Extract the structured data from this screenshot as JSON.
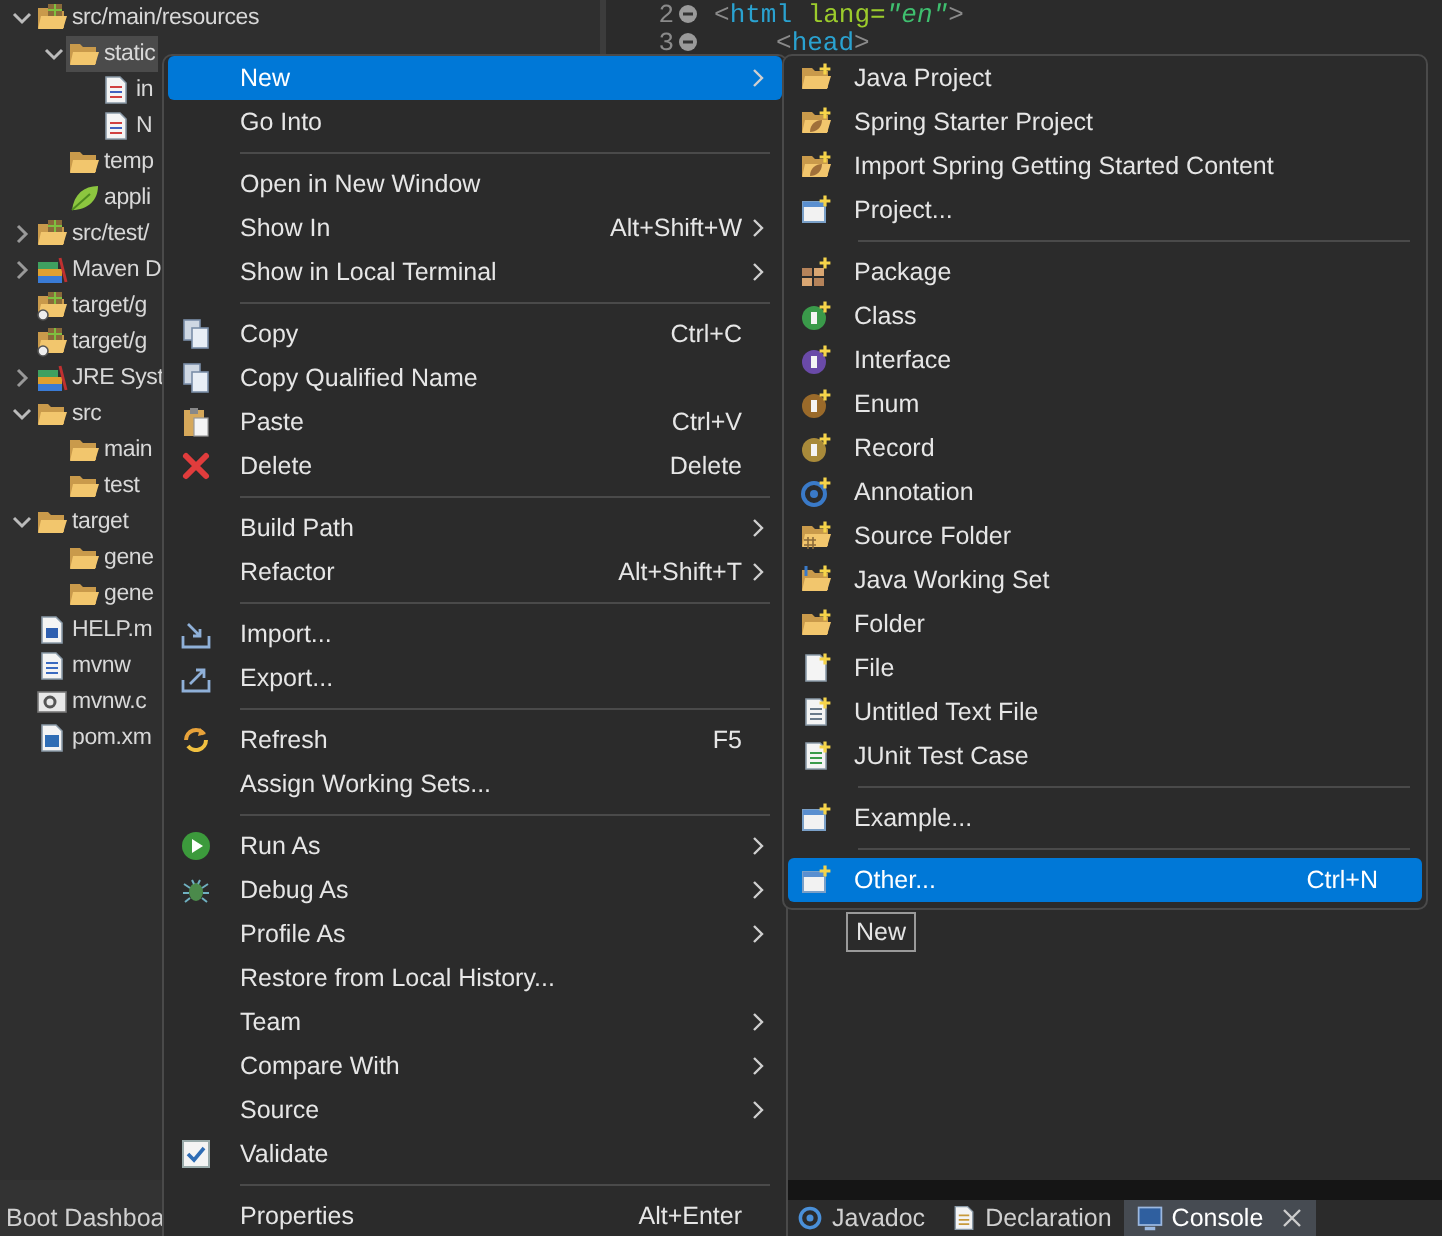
{
  "project_tree": [
    {
      "label": "src/main/resources",
      "kind": "package-folder",
      "expanded": true,
      "selected": false,
      "children": [
        {
          "label": "static",
          "kind": "folder",
          "expanded": true,
          "selected": true,
          "children": [
            {
              "label": "in",
              "kind": "html-file",
              "selected": false
            },
            {
              "label": "N",
              "kind": "html-file",
              "selected": false
            }
          ]
        },
        {
          "label": "temp",
          "kind": "folder",
          "selected": false
        },
        {
          "label": "appli",
          "kind": "spring-file",
          "selected": false
        }
      ]
    },
    {
      "label": "src/test/",
      "kind": "package-folder",
      "expanded": false,
      "selected": false
    },
    {
      "label": "Maven D",
      "kind": "library",
      "expanded": false,
      "selected": false
    },
    {
      "label": "target/g",
      "kind": "linked-package-folder",
      "selected": false
    },
    {
      "label": "target/g",
      "kind": "linked-package-folder",
      "selected": false
    },
    {
      "label": "JRE Syst",
      "kind": "library",
      "expanded": false,
      "selected": false
    },
    {
      "label": "src",
      "kind": "folder",
      "expanded": true,
      "selected": false,
      "children": [
        {
          "label": "main",
          "kind": "folder",
          "selected": false
        },
        {
          "label": "test",
          "kind": "folder",
          "selected": false
        }
      ]
    },
    {
      "label": "target",
      "kind": "folder",
      "expanded": true,
      "selected": false,
      "children": [
        {
          "label": "gene",
          "kind": "folder",
          "selected": false
        },
        {
          "label": "gene",
          "kind": "folder",
          "selected": false
        }
      ]
    },
    {
      "label": "HELP.m",
      "kind": "word-file",
      "selected": false
    },
    {
      "label": "mvnw",
      "kind": "text-file",
      "selected": false
    },
    {
      "label": "mvnw.c",
      "kind": "script-file",
      "selected": false
    },
    {
      "label": "pom.xm",
      "kind": "maven-file",
      "selected": false
    }
  ],
  "editor": {
    "lines": [
      {
        "number": "2",
        "indented": false,
        "tokens": [
          {
            "kind": "punct",
            "text": "<"
          },
          {
            "kind": "tag",
            "text": "html"
          },
          {
            "kind": "attr",
            "text": " lang="
          },
          {
            "kind": "value",
            "text": "\"en\""
          },
          {
            "kind": "punct",
            "text": ">"
          }
        ]
      },
      {
        "number": "3",
        "indented": true,
        "tokens": [
          {
            "kind": "punct",
            "text": "<"
          },
          {
            "kind": "tag",
            "text": "head"
          },
          {
            "kind": "punct",
            "text": ">"
          }
        ]
      }
    ]
  },
  "left_view_tab": {
    "label": "Boot Dashboa"
  },
  "view_tabs": [
    {
      "label": "Javadoc",
      "selected": false,
      "closable": false
    },
    {
      "label": "Declaration",
      "selected": false,
      "closable": false
    },
    {
      "label": "Console",
      "selected": true,
      "closable": true
    }
  ],
  "context_menu": {
    "items": [
      {
        "kind": "item",
        "label": "New",
        "submenu": true,
        "selected": true
      },
      {
        "kind": "item",
        "label": "Go Into",
        "submenu": false,
        "selected": false
      },
      {
        "kind": "separator"
      },
      {
        "kind": "item",
        "label": "Open in New Window",
        "submenu": false,
        "selected": false
      },
      {
        "kind": "item",
        "label": "Show In",
        "shortcut": "Alt+Shift+W",
        "submenu": true,
        "selected": false
      },
      {
        "kind": "item",
        "label": "Show in Local Terminal",
        "submenu": true,
        "selected": false
      },
      {
        "kind": "separator"
      },
      {
        "kind": "item",
        "label": "Copy",
        "shortcut": "Ctrl+C",
        "submenu": false,
        "selected": false
      },
      {
        "kind": "item",
        "label": "Copy Qualified Name",
        "submenu": false,
        "selected": false
      },
      {
        "kind": "item",
        "label": "Paste",
        "shortcut": "Ctrl+V",
        "submenu": false,
        "selected": false
      },
      {
        "kind": "item",
        "label": "Delete",
        "shortcut": "Delete",
        "submenu": false,
        "selected": false
      },
      {
        "kind": "separator"
      },
      {
        "kind": "item",
        "label": "Build Path",
        "submenu": true,
        "selected": false
      },
      {
        "kind": "item",
        "label": "Refactor",
        "shortcut": "Alt+Shift+T",
        "submenu": true,
        "selected": false
      },
      {
        "kind": "separator"
      },
      {
        "kind": "item",
        "label": "Import...",
        "submenu": false,
        "selected": false
      },
      {
        "kind": "item",
        "label": "Export...",
        "submenu": false,
        "selected": false
      },
      {
        "kind": "separator"
      },
      {
        "kind": "item",
        "label": "Refresh",
        "shortcut": "F5",
        "submenu": false,
        "selected": false
      },
      {
        "kind": "item",
        "label": "Assign Working Sets...",
        "submenu": false,
        "selected": false
      },
      {
        "kind": "separator"
      },
      {
        "kind": "item",
        "label": "Run As",
        "submenu": true,
        "selected": false
      },
      {
        "kind": "item",
        "label": "Debug As",
        "submenu": true,
        "selected": false
      },
      {
        "kind": "item",
        "label": "Profile As",
        "submenu": true,
        "selected": false
      },
      {
        "kind": "item",
        "label": "Restore from Local History...",
        "submenu": false,
        "selected": false
      },
      {
        "kind": "item",
        "label": "Team",
        "submenu": true,
        "selected": false
      },
      {
        "kind": "item",
        "label": "Compare With",
        "submenu": true,
        "selected": false
      },
      {
        "kind": "item",
        "label": "Source",
        "submenu": true,
        "selected": false
      },
      {
        "kind": "item",
        "label": "Validate",
        "submenu": false,
        "selected": false
      },
      {
        "kind": "separator"
      },
      {
        "kind": "item",
        "label": "Properties",
        "shortcut": "Alt+Enter",
        "submenu": false,
        "selected": false
      }
    ]
  },
  "new_submenu": {
    "items": [
      {
        "kind": "item",
        "label": "Java Project",
        "submenu": false,
        "selected": false
      },
      {
        "kind": "item",
        "label": "Spring Starter Project",
        "submenu": false,
        "selected": false
      },
      {
        "kind": "item",
        "label": "Import Spring Getting Started Content",
        "submenu": false,
        "selected": false
      },
      {
        "kind": "item",
        "label": "Project...",
        "submenu": false,
        "selected": false
      },
      {
        "kind": "separator"
      },
      {
        "kind": "item",
        "label": "Package",
        "submenu": false,
        "selected": false
      },
      {
        "kind": "item",
        "label": "Class",
        "submenu": false,
        "selected": false
      },
      {
        "kind": "item",
        "label": "Interface",
        "submenu": false,
        "selected": false
      },
      {
        "kind": "item",
        "label": "Enum",
        "submenu": false,
        "selected": false
      },
      {
        "kind": "item",
        "label": "Record",
        "submenu": false,
        "selected": false
      },
      {
        "kind": "item",
        "label": "Annotation",
        "submenu": false,
        "selected": false
      },
      {
        "kind": "item",
        "label": "Source Folder",
        "submenu": false,
        "selected": false
      },
      {
        "kind": "item",
        "label": "Java Working Set",
        "submenu": false,
        "selected": false
      },
      {
        "kind": "item",
        "label": "Folder",
        "submenu": false,
        "selected": false
      },
      {
        "kind": "item",
        "label": "File",
        "submenu": false,
        "selected": false
      },
      {
        "kind": "item",
        "label": "Untitled Text File",
        "submenu": false,
        "selected": false
      },
      {
        "kind": "item",
        "label": "JUnit Test Case",
        "submenu": false,
        "selected": false
      },
      {
        "kind": "separator"
      },
      {
        "kind": "item",
        "label": "Example...",
        "submenu": false,
        "selected": false
      },
      {
        "kind": "separator"
      },
      {
        "kind": "item",
        "label": "Other...",
        "shortcut": "Ctrl+N",
        "submenu": false,
        "selected": true
      }
    ]
  },
  "tooltip": {
    "text": "New"
  }
}
